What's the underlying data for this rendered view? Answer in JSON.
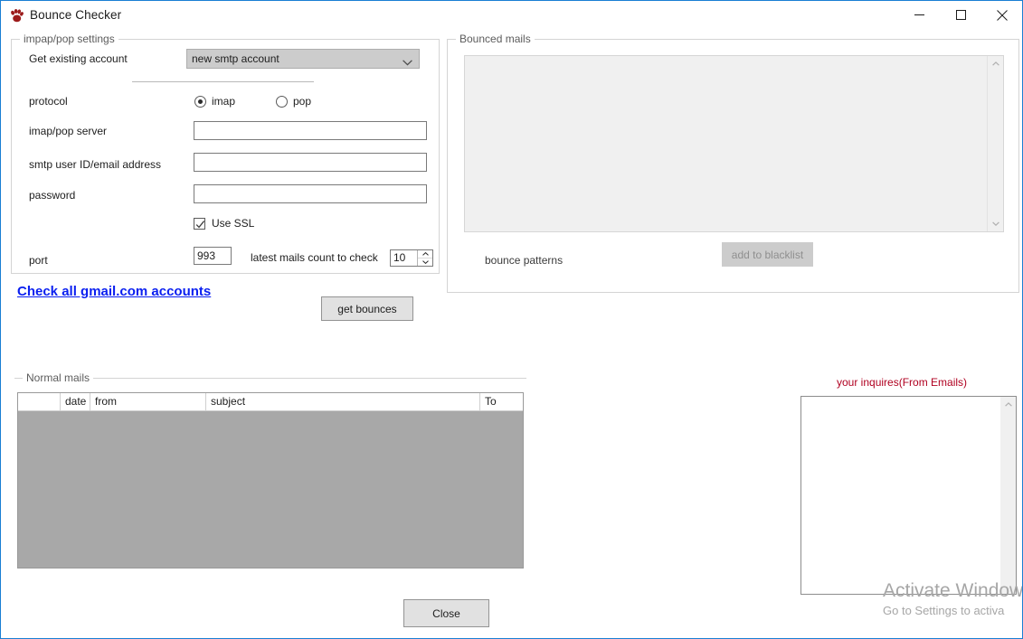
{
  "window": {
    "title": "Bounce Checker",
    "icon": "paw-print-icon",
    "accent_border_color": "#1a7fd4",
    "controls": {
      "minimize": "minimize-icon",
      "maximize": "maximize-icon",
      "close": "close-icon"
    }
  },
  "imap_settings": {
    "group_label": "impap/pop settings",
    "account_label": "Get existing account",
    "account_value": "new smtp account",
    "protocol_label": "protocol",
    "protocol_options": [
      {
        "label": "imap",
        "selected": true
      },
      {
        "label": "pop",
        "selected": false
      }
    ],
    "server_label": "imap/pop server",
    "server_value": "",
    "user_label": "smtp user ID/email address",
    "user_value": "",
    "password_label": "password",
    "password_value": "",
    "ssl_label": "Use SSL",
    "ssl_checked": true,
    "port_label": "port",
    "port_value": "993",
    "latest_count_label": "latest mails count to check",
    "latest_count_value": "10"
  },
  "links": {
    "check_all_gmail": "Check all gmail.com accounts",
    "link_color": "#0a1ff0"
  },
  "actions": {
    "get_bounces": "get bounces",
    "add_to_blacklist": "add to blacklist",
    "add_to_blacklist_enabled": false,
    "close": "Close"
  },
  "bounced_mails": {
    "group_label": "Bounced mails",
    "list_items": [],
    "list_background": "#f0f0f0",
    "bounce_patterns_label": "bounce patterns"
  },
  "normal_mails": {
    "group_label": "Normal mails",
    "columns": [
      "",
      "date",
      "from",
      "subject",
      "To"
    ],
    "rows": [],
    "body_color": "#a8a8a8"
  },
  "inquires": {
    "label": "your inquires(From Emails)",
    "label_color": "#b00020",
    "value": ""
  },
  "watermark": {
    "title": "Activate Windows",
    "subtitle": "Go to Settings to activa"
  }
}
